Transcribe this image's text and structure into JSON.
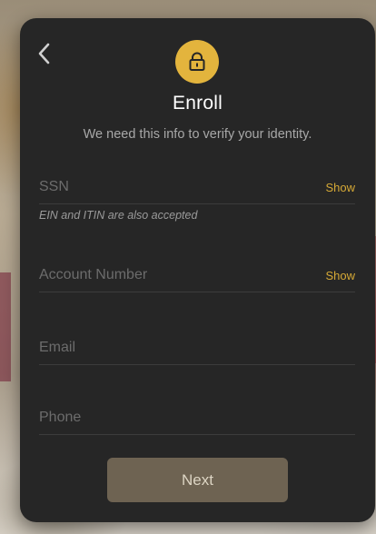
{
  "colors": {
    "card_background": "#262626",
    "accent": "#e3b43d",
    "link": "#d6a936",
    "button_background": "#6e6352",
    "title_text": "#ffffff",
    "subtitle_text": "#a8a8a8",
    "placeholder_text": "#6c6c6c"
  },
  "header": {
    "back_icon": "chevron-left-icon",
    "badge_icon": "lock-icon",
    "title": "Enroll",
    "subtitle": "We need this info to verify your identity."
  },
  "form": {
    "ssn": {
      "placeholder": "SSN",
      "value": "",
      "show_label": "Show",
      "hint": "EIN and ITIN are also accepted"
    },
    "account_number": {
      "placeholder": "Account Number",
      "value": "",
      "show_label": "Show"
    },
    "email": {
      "placeholder": "Email",
      "value": ""
    },
    "phone": {
      "placeholder": "Phone",
      "value": ""
    }
  },
  "actions": {
    "next_label": "Next"
  }
}
